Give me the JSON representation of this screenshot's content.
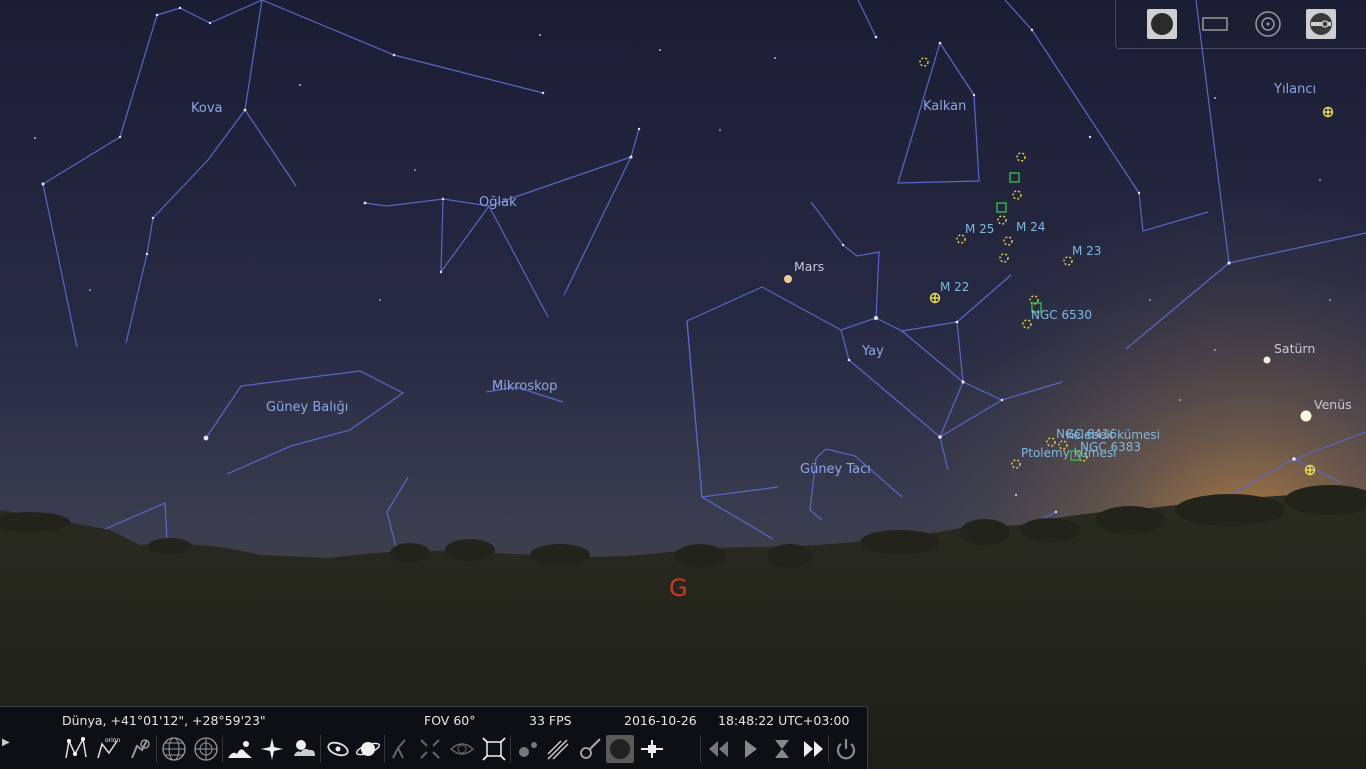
{
  "constellations": {
    "kova": "Kova",
    "kalkan": "Kalkan",
    "yilanci": "Yılancı",
    "oglak": "Oğlak",
    "yay": "Yay",
    "mikroskop": "Mikroskop",
    "guney_baligi": "Güney Balığı",
    "guney_taci": "Güney Tacı"
  },
  "objects": {
    "m25": "M 25",
    "m24": "M 24",
    "m23": "M 23",
    "m22": "M 22",
    "ngc6530": "NGC 6530",
    "ngc6416": "NGC 6416",
    "kelebek": "Kelebek kümesi",
    "ngc6383": "NGC 6383",
    "ptolemy": "Ptolemy kümesi"
  },
  "planets": {
    "mars": "Mars",
    "saturn": "Satürn",
    "venus": "Venüs"
  },
  "cardinal": {
    "west": "G"
  },
  "status": {
    "location": "Dünya, +41°01'12\", +28°59'23\"",
    "fov": "FOV 60°",
    "fps": "33 FPS",
    "date": "2016-10-26",
    "time": "18:48:22 UTC+03:00"
  },
  "colors": {
    "constellation_line": "#5b66c8",
    "constellation_label": "#8ea6e6",
    "cluster_marker": "#e6d64a",
    "nebula_marker": "#39c24a",
    "cardinal": "#c63a26"
  }
}
